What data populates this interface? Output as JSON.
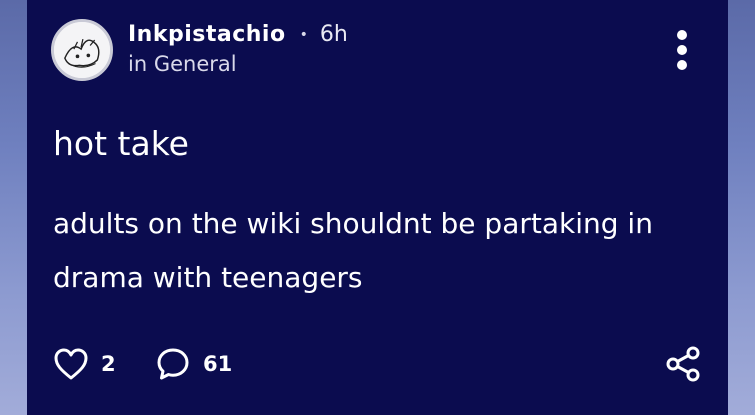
{
  "post": {
    "author": "Inkpistachio",
    "separator": "•",
    "time": "6h",
    "community": "in General",
    "title": "hot take",
    "body": "adults on the wiki shouldnt be partaking in drama with teenagers"
  },
  "footer": {
    "likes": "2",
    "comments": "61"
  },
  "icons": {
    "like": "heart-icon",
    "comment": "speech-bubble-icon",
    "share": "share-icon",
    "more": "vertical-ellipsis-icon"
  },
  "colors": {
    "card_background": "#0b0c4f",
    "text": "#ffffff"
  }
}
